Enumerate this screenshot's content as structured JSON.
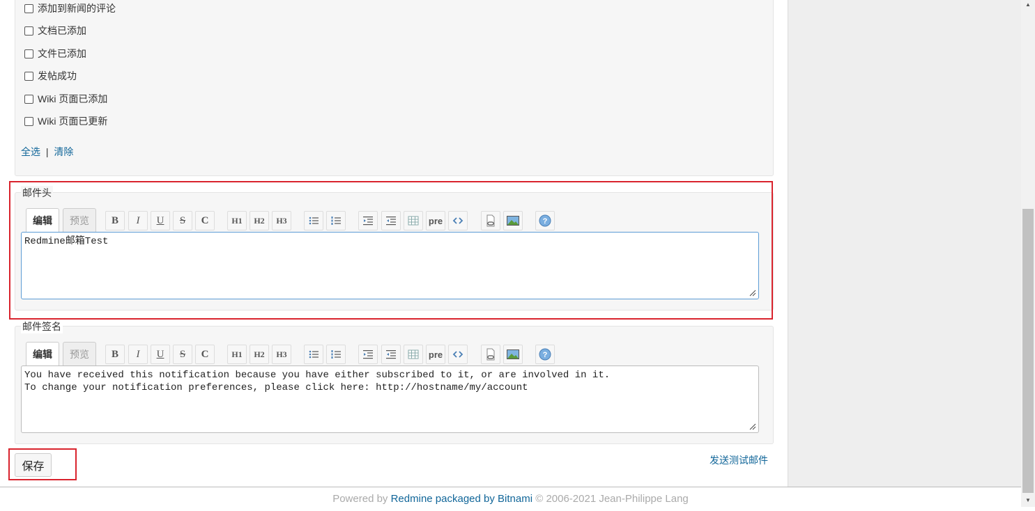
{
  "notifications": {
    "checkboxes": [
      {
        "label": "添加到新闻的评论",
        "checked": false
      },
      {
        "label": "文档已添加",
        "checked": false
      },
      {
        "label": "文件已添加",
        "checked": false
      },
      {
        "label": "发帖成功",
        "checked": false
      },
      {
        "label": "Wiki 页面已添加",
        "checked": false
      },
      {
        "label": "Wiki 页面已更新",
        "checked": false
      }
    ],
    "select_all": "全选",
    "separator": "|",
    "clear": "清除"
  },
  "header_section": {
    "legend": "邮件头",
    "tab_edit": "编辑",
    "tab_preview": "预览",
    "text": "Redmine邮箱Test"
  },
  "footer_section": {
    "legend": "邮件签名",
    "tab_edit": "编辑",
    "tab_preview": "预览",
    "text": "You have received this notification because you have either subscribed to it, or are involved in it.\nTo change your notification preferences, please click here: http://hostname/my/account"
  },
  "toolbar": {
    "bold": "B",
    "italic": "I",
    "underline": "U",
    "strike": "S",
    "code": "C",
    "h1": "H1",
    "h2": "H2",
    "h3": "H3",
    "pre": "pre",
    "icons": [
      "bold-icon",
      "italic-icon",
      "underline-icon",
      "strikethrough-icon",
      "inline-code-icon",
      "heading1-icon",
      "heading2-icon",
      "heading3-icon",
      "unordered-list-icon",
      "ordered-list-icon",
      "quote-icon",
      "unquote-icon",
      "table-icon",
      "pre-icon",
      "code-highlight-icon",
      "link-icon",
      "image-icon",
      "help-icon"
    ]
  },
  "actions": {
    "save": "保存",
    "send_test": "发送测试邮件"
  },
  "footer": {
    "powered_by": "Powered by",
    "redmine": "Redmine packaged by Bitnami",
    "copyright": "© 2006-2021 Jean-Philippe Lang"
  },
  "colors": {
    "highlight_border": "#d9232d",
    "link": "#116699",
    "panel_bg": "#f6f6f6"
  }
}
